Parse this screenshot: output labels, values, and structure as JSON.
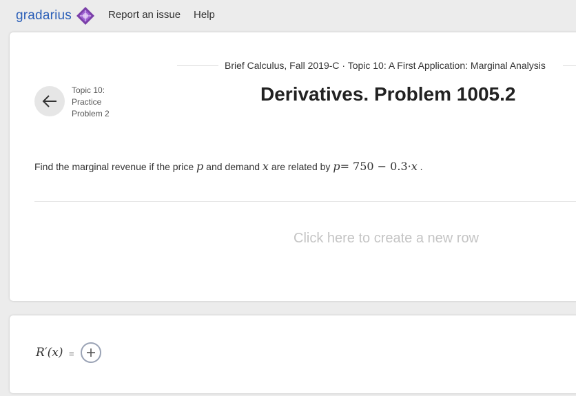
{
  "nav": {
    "brand": "gradarius",
    "report_label": "Report an issue",
    "help_label": "Help"
  },
  "breadcrumb": "Brief Calculus, Fall 2019-C · Topic 10: A First Application: Marginal Analysis",
  "side": {
    "line1": "Topic 10:",
    "line2": "Practice",
    "line3": "Problem 2"
  },
  "title": "Derivatives. Problem 1005.2",
  "problem": {
    "part1": "Find the marginal revenue if the price",
    "var_p": "p",
    "part2": "and demand",
    "var_x": "x",
    "part3": "are related by",
    "formula_lhs": "p",
    "formula_rhs": "= 750 − 0.3·",
    "formula_x": "x",
    "end": "."
  },
  "new_row_label": "Click here to create a new row",
  "answer": {
    "label": "R′(x)",
    "eq": "="
  },
  "colors": {
    "brand": "#2b5fb8",
    "logo": "#7a3fa8",
    "background": "#ececec"
  }
}
